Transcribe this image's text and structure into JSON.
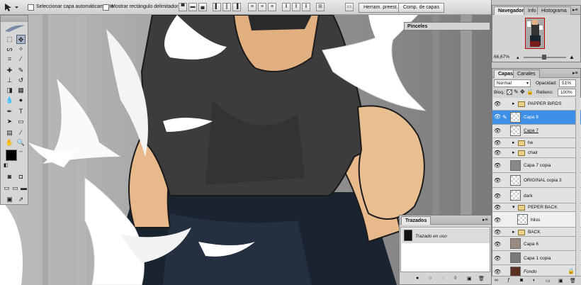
{
  "options_bar": {
    "auto_select_label": "Seleccionar capa automáticamente",
    "show_bounds_label": "Mostrar rectángulo delimitador",
    "brushes_tab": "Herram. preest.",
    "layer_comps_tab": "Comp. de capas"
  },
  "brushes_panel": {
    "title": "Pinceles"
  },
  "navigator": {
    "tabs": [
      "Navegador",
      "Info",
      "Histograma"
    ],
    "zoom": "66,67%"
  },
  "layers": {
    "tabs": [
      "Capas",
      "Canales"
    ],
    "blend_mode": "Normal",
    "opacity_label": "Opacidad:",
    "opacity_value": "51%",
    "lock_label": "Bloq.:",
    "fill_label": "Relleno:",
    "fill_value": "100%",
    "items": [
      {
        "name": "PAPPER BIRDS",
        "group": true,
        "open": false
      },
      {
        "name": "Capa 8",
        "group": false,
        "selected": true
      },
      {
        "name": "Capa 7",
        "group": false
      },
      {
        "name": "he",
        "group": true,
        "open": false
      },
      {
        "name": "chair",
        "group": true,
        "open": false
      },
      {
        "name": "Capa 7 copia",
        "group": false
      },
      {
        "name": "ORIGINAL copia 3",
        "group": false
      },
      {
        "name": "dark",
        "group": false
      },
      {
        "name": "PEPER BACK",
        "group": true,
        "open": true
      },
      {
        "name": "hilos",
        "group": false,
        "indent": true
      },
      {
        "name": "BACK",
        "group": true,
        "open": false
      },
      {
        "name": "Capa 6",
        "group": false
      },
      {
        "name": "Capa 1 copia",
        "group": false
      },
      {
        "name": "Fondo",
        "group": false,
        "italic": true
      }
    ]
  },
  "paths": {
    "title": "Trazados",
    "item": "Trazado en uso"
  }
}
